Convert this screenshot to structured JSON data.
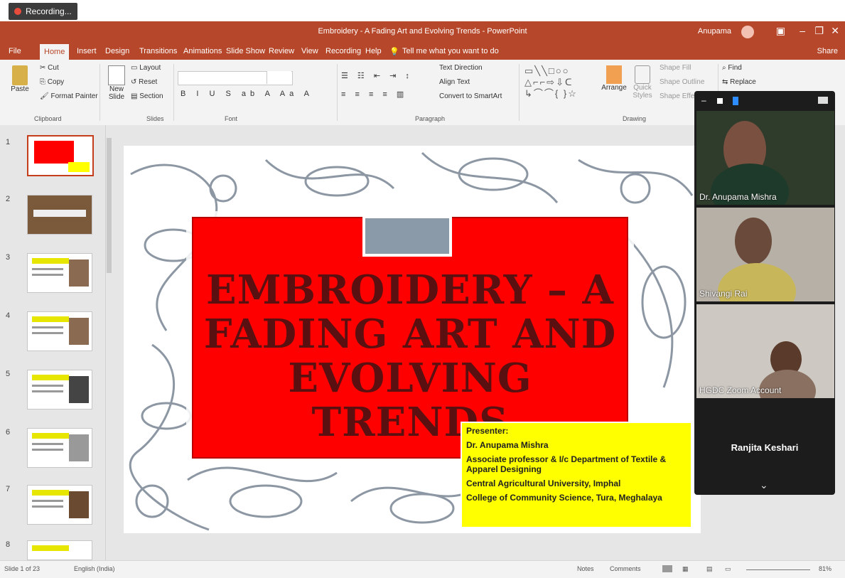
{
  "recording": {
    "label": "Recording..."
  },
  "window": {
    "title": "Embroidery - A Fading Art and Evolving Trends - PowerPoint",
    "user": "Anupama",
    "share": "Share"
  },
  "ribbon_tabs": [
    "File",
    "Home",
    "Insert",
    "Design",
    "Transitions",
    "Animations",
    "Slide Show",
    "Review",
    "View",
    "Recording",
    "Help"
  ],
  "tell_me": "Tell me what you want to do",
  "ribbon": {
    "clipboard": {
      "paste": "Paste",
      "cut": "Cut",
      "copy": "Copy",
      "format_painter": "Format Painter",
      "label": "Clipboard"
    },
    "slides": {
      "new_slide": "New Slide",
      "layout": "Layout",
      "reset": "Reset",
      "section": "Section",
      "label": "Slides"
    },
    "font": {
      "label": "Font"
    },
    "paragraph": {
      "text_direction": "Text Direction",
      "align_text": "Align Text",
      "smartart": "Convert to SmartArt",
      "label": "Paragraph"
    },
    "drawing": {
      "arrange": "Arrange",
      "quick_styles": "Quick Styles",
      "shape_fill": "Shape Fill",
      "shape_outline": "Shape Outline",
      "shape_effects": "Shape Effects",
      "label": "Drawing"
    },
    "editing": {
      "find": "Find",
      "replace": "Replace"
    }
  },
  "thumbnails": [
    "1",
    "2",
    "3",
    "4",
    "5",
    "6",
    "7",
    "8"
  ],
  "slide": {
    "title_lines": [
      "EMBROIDERY – A",
      "FADING ART AND",
      "EVOLVING TRENDS"
    ],
    "presenter": [
      "Presenter:",
      "Dr. Anupama Mishra",
      "Associate professor & I/c Department of Textile & Apparel Designing",
      "Central Agricultural University, Imphal",
      "College of Community Science, Tura, Meghalaya"
    ]
  },
  "zoom": {
    "participants": [
      "Dr. Anupama Mishra",
      "Shivangi Rai",
      "HGDC Zoom Account"
    ],
    "name_only": "Ranjita Keshari"
  },
  "status": {
    "slide": "Slide 1 of 23",
    "language": "English (India)",
    "notes": "Notes",
    "comments": "Comments",
    "zoom": "81%"
  }
}
